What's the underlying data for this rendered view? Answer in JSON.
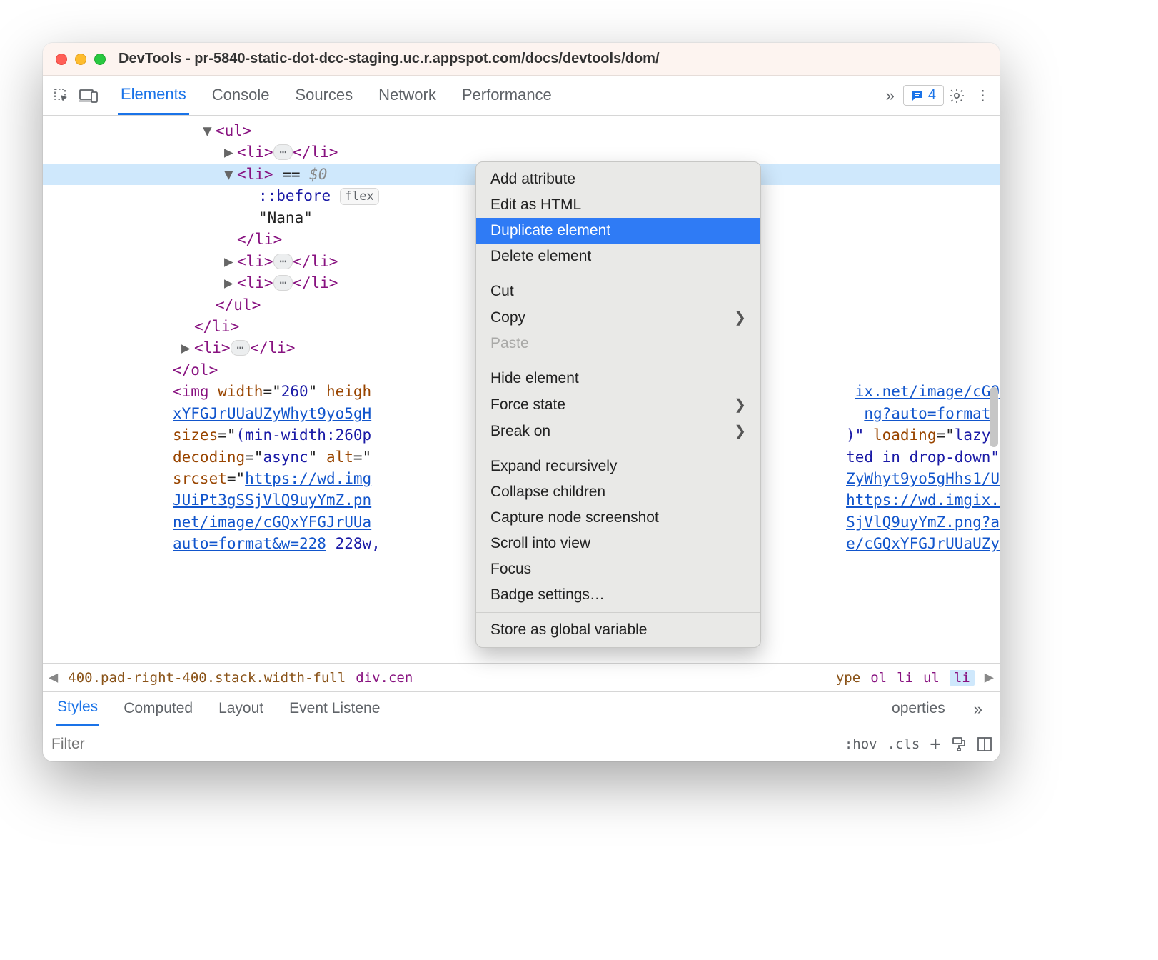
{
  "window": {
    "title": "DevTools - pr-5840-static-dot-dcc-staging.uc.r.appspot.com/docs/devtools/dom/"
  },
  "toolbar": {
    "tabs": [
      "Elements",
      "Console",
      "Sources",
      "Network",
      "Performance"
    ],
    "active_tab": 0,
    "issues_count": "4"
  },
  "dom": {
    "ul_open": "<ul>",
    "li_collapsed": "<li>",
    "li_close_short": "</li>",
    "li_open": "<li>",
    "eq": " == ",
    "dollar0": "$0",
    "before": "::before",
    "flex_label": "flex",
    "nana_text": "\"Nana\"",
    "li_close": "</li>",
    "ul_close": "</ul>",
    "outer_li_close": "</li>",
    "ol_close": "</ol>",
    "img_prefix": "<img",
    "width_attr": " width",
    "width_eq": "=\"",
    "width_val": "260",
    "height_attr": "heigh",
    "sizes_attr": "sizes",
    "sizes_val": "(min-width:260p",
    "loading_attr": " loading",
    "loading_val": "lazy",
    "decoding_attr": "decoding",
    "decoding_val": "async",
    "alt_attr": " alt",
    "srcset_attr": "srcset",
    "url1": "xYFGJrUUaUZyWhyt9yo5gH",
    "url2": "JUiPt3gSSjVlQ9uyYmZ.pn",
    "url3": "net/image/cGQxYFGJrUUa",
    "url4": "auto=format&w=228",
    "w228": " 228w,",
    "url_right_1": "ix.net/image/cGQ",
    "url_right_2": "ng?auto=format",
    "paren_quote": ")\"",
    "alt_right": "ted in drop-down\"",
    "url_right_3": "ZyWhyt9yo5gHhs1/U",
    "url_right_4": "https://wd.imgix.",
    "url_right_5": "SjVlQ9uyYmZ.png?a",
    "url_right_6": "e/cGQxYFGJrUUaUZy",
    "https_link": "https://wd.img"
  },
  "breadcrumbs": {
    "left": "400.pad-right-400.stack.width-full",
    "mid": "div.cen",
    "right_partial": "ype",
    "items": [
      "ol",
      "li",
      "ul",
      "li"
    ]
  },
  "sidetabs": {
    "items": [
      "Styles",
      "Computed",
      "Layout",
      "Event Listene",
      "operties"
    ],
    "active": 0
  },
  "filter": {
    "placeholder": "Filter",
    "hov": ":hov",
    "cls": ".cls"
  },
  "context_menu": {
    "items": [
      {
        "label": "Add attribute"
      },
      {
        "label": "Edit as HTML"
      },
      {
        "label": "Duplicate element",
        "highlight": true
      },
      {
        "label": "Delete element"
      },
      {
        "sep": true
      },
      {
        "label": "Cut"
      },
      {
        "label": "Copy",
        "submenu": true
      },
      {
        "label": "Paste",
        "disabled": true
      },
      {
        "sep": true
      },
      {
        "label": "Hide element"
      },
      {
        "label": "Force state",
        "submenu": true
      },
      {
        "label": "Break on",
        "submenu": true
      },
      {
        "sep": true
      },
      {
        "label": "Expand recursively"
      },
      {
        "label": "Collapse children"
      },
      {
        "label": "Capture node screenshot"
      },
      {
        "label": "Scroll into view"
      },
      {
        "label": "Focus"
      },
      {
        "label": "Badge settings…"
      },
      {
        "sep": true
      },
      {
        "label": "Store as global variable"
      }
    ]
  }
}
